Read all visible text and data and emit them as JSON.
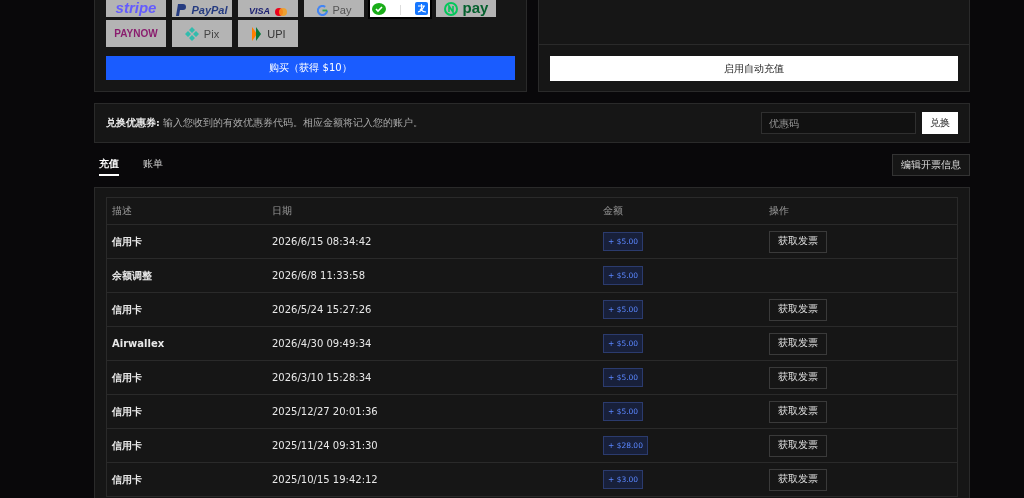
{
  "payment_methods": [
    {
      "kind": "stripe",
      "label": "stripe",
      "selected": false
    },
    {
      "kind": "paypal",
      "label": "PayPal",
      "selected": false
    },
    {
      "kind": "card",
      "label": "VISA",
      "selected": false
    },
    {
      "kind": "gpay",
      "label": "Pay",
      "selected": false
    },
    {
      "kind": "wechat-alipay",
      "selected": true
    },
    {
      "kind": "npay",
      "label": "pay",
      "selected": false
    },
    {
      "kind": "paynow",
      "label": "PAYNOW",
      "selected": false
    },
    {
      "kind": "pix",
      "label": "Pix",
      "selected": false
    },
    {
      "kind": "upi",
      "label": "UPI",
      "selected": false
    }
  ],
  "buy_button": "购买（获得 $10）",
  "auto_recharge_button": "启用自动充值",
  "coupon": {
    "title": "兑换优惠券:",
    "description": "输入您收到的有效优惠券代码。相应金额将记入您的账户。",
    "placeholder": "优惠码",
    "button": "兑换"
  },
  "tabs": [
    {
      "label": "充值",
      "selected": true
    },
    {
      "label": "账单",
      "selected": false
    }
  ],
  "edit_invoice_button": "编辑开票信息",
  "table": {
    "columns": [
      "描述",
      "日期",
      "金额",
      "操作"
    ],
    "rows": [
      {
        "description": "信用卡",
        "date": "2026/6/15 08:34:42",
        "amount": "+ $5.00",
        "action": "获取发票"
      },
      {
        "description": "余额调整",
        "date": "2026/6/8 11:33:58",
        "amount": "+ $5.00"
      },
      {
        "description": "信用卡",
        "date": "2026/5/24 15:27:26",
        "amount": "+ $5.00",
        "action": "获取发票"
      },
      {
        "description": "Airwallex",
        "date": "2026/4/30 09:49:34",
        "amount": "+ $5.00",
        "action": "获取发票"
      },
      {
        "description": "信用卡",
        "date": "2026/3/10 15:28:34",
        "amount": "+ $5.00",
        "action": "获取发票"
      },
      {
        "description": "信用卡",
        "date": "2025/12/27 20:01:36",
        "amount": "+ $5.00",
        "action": "获取发票"
      },
      {
        "description": "信用卡",
        "date": "2025/11/24 09:31:30",
        "amount": "+ $28.00",
        "action": "获取发票"
      },
      {
        "description": "信用卡",
        "date": "2025/10/15 19:42:12",
        "amount": "+ $3.00",
        "action": "获取发票"
      }
    ]
  }
}
